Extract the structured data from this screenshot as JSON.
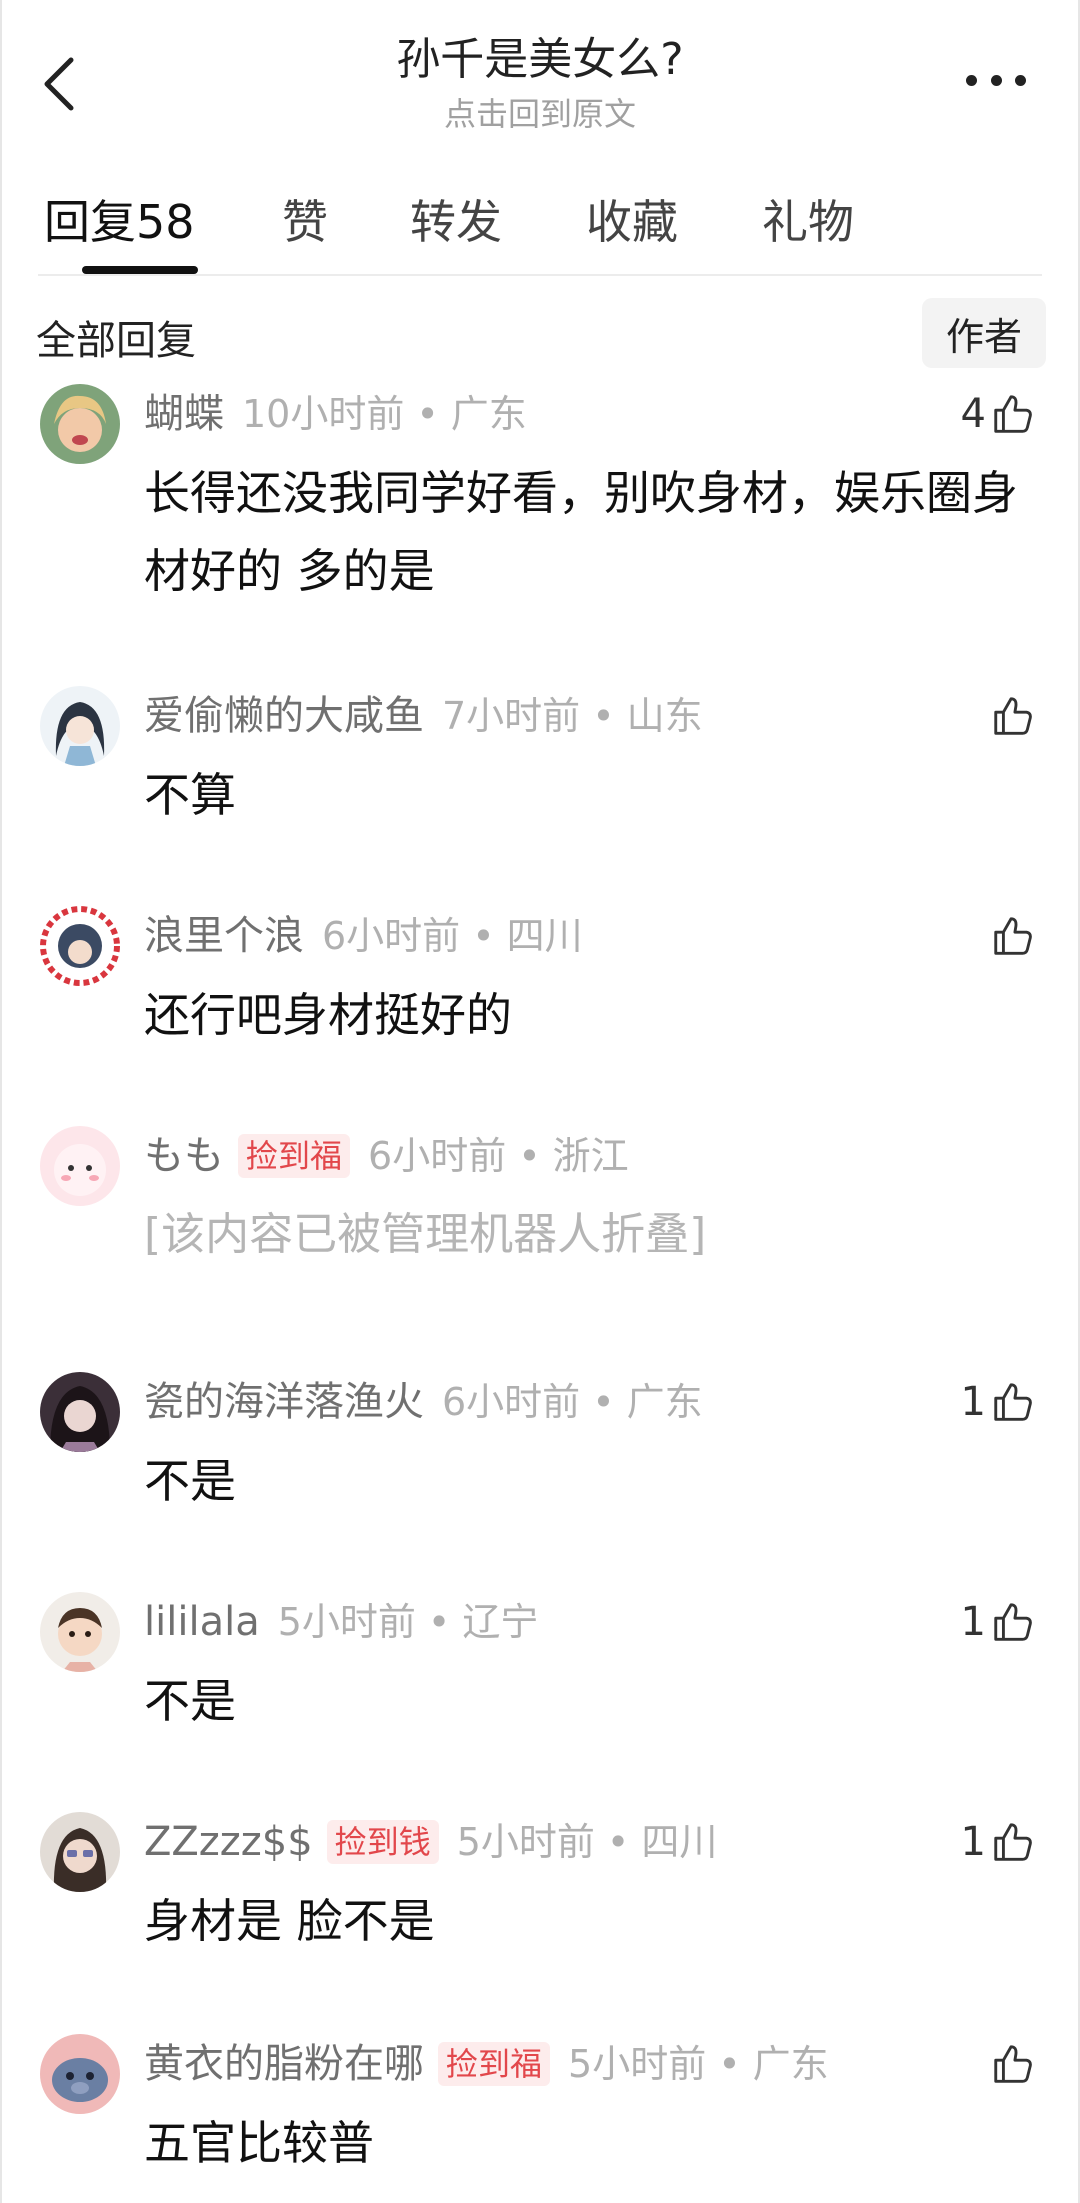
{
  "header": {
    "title": "孙千是美女么?",
    "subtitle": "点击回到原文"
  },
  "tabs": [
    {
      "label": "回复58"
    },
    {
      "label": "赞"
    },
    {
      "label": "转发"
    },
    {
      "label": "收藏"
    },
    {
      "label": "礼物"
    }
  ],
  "section": {
    "title": "全部回复",
    "author_button": "作者"
  },
  "separator": "•",
  "comments": [
    {
      "name": "蝴蝶",
      "badge": "",
      "time": "10小时前",
      "location": "广东",
      "likes": "4",
      "text": "长得还没我同学好看，别吹身材，娱乐圈身材好的 多的是"
    },
    {
      "name": "爱偷懒的大咸鱼",
      "badge": "",
      "time": "7小时前",
      "location": "山东",
      "likes": "",
      "text": "不算"
    },
    {
      "name": "浪里个浪",
      "badge": "",
      "time": "6小时前",
      "location": "四川",
      "likes": "",
      "text": "还行吧身材挺好的"
    },
    {
      "name": "もも",
      "badge": "捡到福",
      "time": "6小时前",
      "location": "浙江",
      "likes": "",
      "text": "[该内容已被管理机器人折叠]"
    },
    {
      "name": "瓷的海洋落渔火",
      "badge": "",
      "time": "6小时前",
      "location": "广东",
      "likes": "1",
      "text": "不是"
    },
    {
      "name": "lililala",
      "badge": "",
      "time": "5小时前",
      "location": "辽宁",
      "likes": "1",
      "text": "不是"
    },
    {
      "name": "ZZzzz$$",
      "badge": "捡到钱",
      "time": "5小时前",
      "location": "四川",
      "likes": "1",
      "text": "身材是 脸不是"
    },
    {
      "name": "黄衣的脂粉在哪",
      "badge": "捡到福",
      "time": "5小时前",
      "location": "广东",
      "likes": "",
      "text": "五官比较普"
    }
  ],
  "colors": {
    "badge_text": "#e2474b",
    "badge_bg": "#fdecec",
    "meta_gray": "#b0b0b0",
    "name_gray": "#707070"
  }
}
